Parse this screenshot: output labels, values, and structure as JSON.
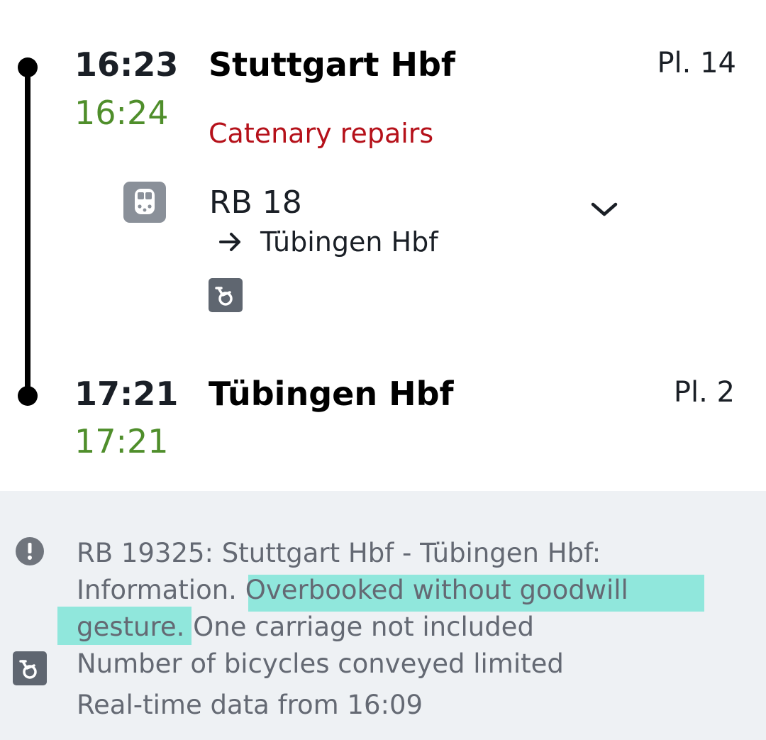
{
  "journey": {
    "departure": {
      "time_planned": "16:23",
      "time_actual": "16:24",
      "station": "Stuttgart Hbf",
      "platform": "Pl. 14"
    },
    "disruption": "Catenary repairs",
    "train": {
      "name": "RB 18",
      "direction": "Tübingen Hbf",
      "icon": "regional-train-icon"
    },
    "arrival": {
      "time_planned": "17:21",
      "time_actual": "17:21",
      "station": "Tübingen Hbf",
      "platform": "Pl. 2"
    }
  },
  "info": {
    "line1": "RB 19325: Stuttgart Hbf - Tübingen Hbf:",
    "line2_a": "Information.",
    "line2_b": " Overbooked without goodwill",
    "line3_a": "gesture.",
    "line3_b": " One carriage not included",
    "bicycle_notice": "Number of bicycles conveyed limited",
    "realtime": "Real-time data from 16:09"
  },
  "colors": {
    "on_time_green": "#4f8e2b",
    "disruption_red": "#b5111a",
    "highlight": "#7fe5d7",
    "panel_bg": "#eef1f4"
  }
}
